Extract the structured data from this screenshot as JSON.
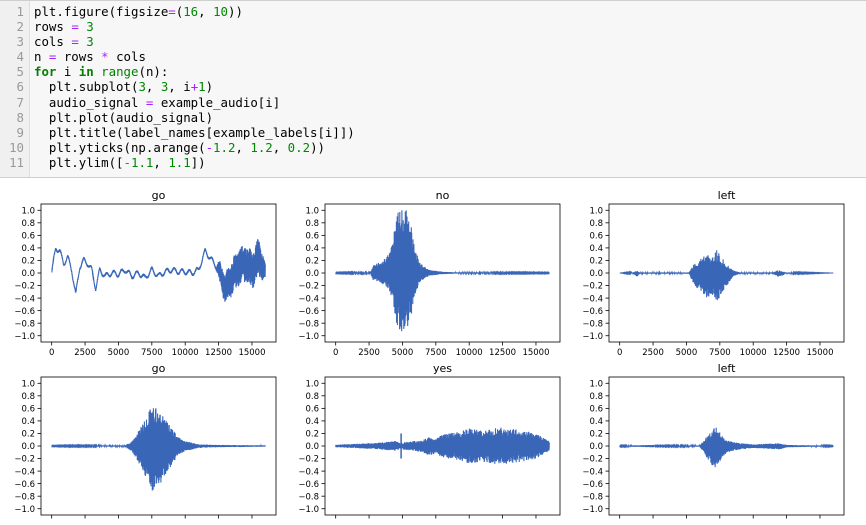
{
  "code_cell": {
    "lines": [
      {
        "n": "1",
        "tokens": [
          [
            "",
            "plt.figure(figsize"
          ],
          [
            "op",
            "="
          ],
          [
            "",
            "("
          ],
          [
            "num",
            "16"
          ],
          [
            "",
            ", "
          ],
          [
            "num",
            "10"
          ],
          [
            "",
            "))"
          ]
        ]
      },
      {
        "n": "2",
        "tokens": [
          [
            "",
            "rows "
          ],
          [
            "op",
            "="
          ],
          [
            "num",
            " 3"
          ]
        ]
      },
      {
        "n": "3",
        "tokens": [
          [
            "",
            "cols "
          ],
          [
            "op",
            "="
          ],
          [
            "num",
            " 3"
          ]
        ]
      },
      {
        "n": "4",
        "tokens": [
          [
            "",
            "n "
          ],
          [
            "op",
            "="
          ],
          [
            "",
            " rows "
          ],
          [
            "op",
            "*"
          ],
          [
            "",
            " cols"
          ]
        ]
      },
      {
        "n": "5",
        "tokens": [
          [
            "kw",
            "for"
          ],
          [
            "",
            " i "
          ],
          [
            "kw",
            "in"
          ],
          [
            "",
            " "
          ],
          [
            "bi",
            "range"
          ],
          [
            "",
            "(n):"
          ]
        ]
      },
      {
        "n": "6",
        "tokens": [
          [
            "",
            "  plt.subplot("
          ],
          [
            "num",
            "3"
          ],
          [
            "",
            ", "
          ],
          [
            "num",
            "3"
          ],
          [
            "",
            ", i"
          ],
          [
            "op",
            "+"
          ],
          [
            "num",
            "1"
          ],
          [
            "",
            ")"
          ]
        ]
      },
      {
        "n": "7",
        "tokens": [
          [
            "",
            "  audio_signal "
          ],
          [
            "op",
            "="
          ],
          [
            "",
            " example_audio[i]"
          ]
        ]
      },
      {
        "n": "8",
        "tokens": [
          [
            "",
            "  plt.plot(audio_signal)"
          ]
        ]
      },
      {
        "n": "9",
        "tokens": [
          [
            "",
            "  plt.title(label_names[example_labels[i]])"
          ]
        ]
      },
      {
        "n": "10",
        "tokens": [
          [
            "",
            "  plt.yticks(np.arange("
          ],
          [
            "op",
            "-"
          ],
          [
            "num",
            "1.2"
          ],
          [
            "",
            ", "
          ],
          [
            "num",
            "1.2"
          ],
          [
            "",
            ", "
          ],
          [
            "num",
            "0.2"
          ],
          [
            "",
            "))"
          ]
        ]
      },
      {
        "n": "11",
        "tokens": [
          [
            "",
            "  plt.ylim(["
          ],
          [
            "op",
            "-"
          ],
          [
            "num",
            "1.1"
          ],
          [
            "",
            ", "
          ],
          [
            "num",
            "1.1"
          ],
          [
            "",
            "])"
          ]
        ]
      }
    ]
  },
  "chart_data": [
    {
      "type": "line",
      "title": "go",
      "ylim": [
        -1.1,
        1.1
      ],
      "xlim": [
        -800,
        16800
      ],
      "yticks": [
        "1.0",
        "0.8",
        "0.6",
        "0.4",
        "0.2",
        "0.0",
        "−0.2",
        "−0.4",
        "−0.6",
        "−0.8",
        "−1.0"
      ],
      "xticks": [
        "0",
        "2500",
        "5000",
        "7500",
        "10000",
        "12500",
        "15000"
      ],
      "series_color": "#3a66b8",
      "envelope": [
        [
          0,
          0.0
        ],
        [
          300,
          0.4
        ],
        [
          600,
          0.35
        ],
        [
          900,
          0.15
        ],
        [
          1200,
          0.25
        ],
        [
          1500,
          0.05
        ],
        [
          1800,
          -0.35
        ],
        [
          2100,
          0.1
        ],
        [
          2400,
          0.2
        ],
        [
          2700,
          0.15
        ],
        [
          3000,
          0.05
        ],
        [
          3300,
          -0.25
        ],
        [
          3600,
          0.05
        ],
        [
          4000,
          -0.05
        ],
        [
          4500,
          0.0
        ],
        [
          5000,
          -0.02
        ],
        [
          5500,
          0.05
        ],
        [
          6000,
          -0.05
        ],
        [
          6500,
          0.0
        ],
        [
          7000,
          -0.08
        ],
        [
          7500,
          0.05
        ],
        [
          8000,
          -0.05
        ],
        [
          8500,
          0.02
        ],
        [
          9000,
          0.05
        ],
        [
          9500,
          0.02
        ],
        [
          10000,
          0.02
        ],
        [
          10500,
          0.0
        ],
        [
          11000,
          0.05
        ],
        [
          11500,
          0.35
        ],
        [
          12000,
          0.2
        ],
        [
          12500,
          0.05
        ],
        [
          13000,
          -0.25
        ],
        [
          13500,
          -0.1
        ],
        [
          14000,
          0.1
        ],
        [
          14500,
          0.15
        ],
        [
          15000,
          0.05
        ],
        [
          15500,
          0.25
        ],
        [
          16000,
          0.0
        ]
      ],
      "noise": [
        [
          0,
          0.02
        ],
        [
          12300,
          0.02
        ],
        [
          12600,
          0.18
        ],
        [
          13500,
          0.28
        ],
        [
          14500,
          0.28
        ],
        [
          15500,
          0.3
        ],
        [
          16000,
          0.15
        ]
      ]
    },
    {
      "type": "line",
      "title": "no",
      "ylim": [
        -1.1,
        1.1
      ],
      "xlim": [
        -800,
        16800
      ],
      "yticks": [
        "1.0",
        "0.8",
        "0.6",
        "0.4",
        "0.2",
        "0.0",
        "−0.2",
        "−0.4",
        "−0.6",
        "−0.8",
        "−1.0"
      ],
      "xticks": [
        "0",
        "2500",
        "5000",
        "7500",
        "10000",
        "12500",
        "15000"
      ],
      "series_color": "#3a66b8",
      "envelope": [
        [
          0,
          0
        ],
        [
          16000,
          0
        ]
      ],
      "noise": [
        [
          0,
          0.005
        ],
        [
          2600,
          0.01
        ],
        [
          2800,
          0.12
        ],
        [
          3500,
          0.18
        ],
        [
          4000,
          0.3
        ],
        [
          4300,
          0.55
        ],
        [
          4600,
          0.9
        ],
        [
          4900,
          0.98
        ],
        [
          5300,
          0.95
        ],
        [
          5600,
          0.8
        ],
        [
          5900,
          0.4
        ],
        [
          6300,
          0.15
        ],
        [
          7000,
          0.05
        ],
        [
          8000,
          0.02
        ],
        [
          9000,
          0.01
        ],
        [
          16000,
          0.005
        ]
      ],
      "skew": 0.05
    },
    {
      "type": "line",
      "title": "left",
      "ylim": [
        -1.1,
        1.1
      ],
      "xlim": [
        -800,
        16800
      ],
      "yticks": [
        "1.0",
        "0.8",
        "0.6",
        "0.4",
        "0.2",
        "0.0",
        "−0.2",
        "−0.4",
        "−0.6",
        "−0.8",
        "−1.0"
      ],
      "xticks": [
        "0",
        "2500",
        "5000",
        "7500",
        "10000",
        "12500",
        "15000"
      ],
      "series_color": "#3a66b8",
      "envelope": [
        [
          0,
          0
        ],
        [
          16000,
          0
        ]
      ],
      "noise": [
        [
          0,
          0.0
        ],
        [
          1000,
          0.01
        ],
        [
          1300,
          0.05
        ],
        [
          1500,
          0.01
        ],
        [
          5200,
          0.01
        ],
        [
          5500,
          0.15
        ],
        [
          6000,
          0.25
        ],
        [
          6500,
          0.35
        ],
        [
          7000,
          0.3
        ],
        [
          7300,
          0.45
        ],
        [
          7600,
          0.3
        ],
        [
          8000,
          0.18
        ],
        [
          8500,
          0.05
        ],
        [
          9000,
          0.01
        ],
        [
          11500,
          0.01
        ],
        [
          11800,
          0.05
        ],
        [
          12100,
          0.05
        ],
        [
          12400,
          0.01
        ],
        [
          16000,
          0.0
        ]
      ],
      "skew": -0.15
    },
    {
      "type": "line",
      "title": "go",
      "ylim": [
        -1.1,
        1.1
      ],
      "xlim": [
        -800,
        16800
      ],
      "yticks": [
        "1.0",
        "0.8",
        "0.6",
        "0.4",
        "0.2",
        "0.0",
        "−0.2",
        "−0.4",
        "−0.6",
        "−0.8",
        "−1.0"
      ],
      "xticks": [],
      "series_color": "#3a66b8",
      "envelope": [
        [
          0,
          0
        ],
        [
          16000,
          0
        ]
      ],
      "noise": [
        [
          0,
          0.005
        ],
        [
          5500,
          0.01
        ],
        [
          6000,
          0.08
        ],
        [
          6500,
          0.25
        ],
        [
          7000,
          0.45
        ],
        [
          7500,
          0.68
        ],
        [
          8000,
          0.62
        ],
        [
          8500,
          0.45
        ],
        [
          9000,
          0.3
        ],
        [
          9500,
          0.15
        ],
        [
          10000,
          0.08
        ],
        [
          11000,
          0.03
        ],
        [
          12000,
          0.02
        ],
        [
          16000,
          0.01
        ]
      ],
      "skew": -0.05
    },
    {
      "type": "line",
      "title": "yes",
      "ylim": [
        -1.1,
        1.1
      ],
      "xlim": [
        -800,
        16800
      ],
      "yticks": [
        "1.0",
        "0.8",
        "0.6",
        "0.4",
        "0.2",
        "0.0",
        "−0.2",
        "−0.4",
        "−0.6",
        "−0.8",
        "−1.0"
      ],
      "xticks": [],
      "series_color": "#3a66b8",
      "envelope": [
        [
          0,
          0
        ],
        [
          16000,
          0
        ]
      ],
      "noise": [
        [
          0,
          0.02
        ],
        [
          3000,
          0.05
        ],
        [
          4500,
          0.08
        ],
        [
          4800,
          0.05
        ],
        [
          6500,
          0.1
        ],
        [
          7000,
          0.15
        ],
        [
          7500,
          0.12
        ],
        [
          8000,
          0.18
        ],
        [
          9000,
          0.22
        ],
        [
          10000,
          0.28
        ],
        [
          11000,
          0.25
        ],
        [
          12000,
          0.3
        ],
        [
          13000,
          0.28
        ],
        [
          14000,
          0.25
        ],
        [
          15000,
          0.2
        ],
        [
          16000,
          0.08
        ]
      ],
      "spikes": [
        [
          4900,
          0.2
        ]
      ]
    },
    {
      "type": "line",
      "title": "left",
      "ylim": [
        -1.1,
        1.1
      ],
      "xlim": [
        -800,
        16800
      ],
      "yticks": [
        "1.0",
        "0.8",
        "0.6",
        "0.4",
        "0.2",
        "0.0",
        "−0.2",
        "−0.4",
        "−0.6",
        "−0.8",
        "−1.0"
      ],
      "xticks": [],
      "series_color": "#3a66b8",
      "envelope": [
        [
          0,
          0
        ],
        [
          16000,
          0
        ]
      ],
      "noise": [
        [
          0,
          0.005
        ],
        [
          2500,
          0.02
        ],
        [
          2700,
          0.005
        ],
        [
          6000,
          0.01
        ],
        [
          6300,
          0.1
        ],
        [
          6800,
          0.25
        ],
        [
          7200,
          0.35
        ],
        [
          7600,
          0.2
        ],
        [
          8000,
          0.1
        ],
        [
          9000,
          0.05
        ],
        [
          10000,
          0.03
        ],
        [
          12000,
          0.05
        ],
        [
          12500,
          0.02
        ],
        [
          16000,
          0.005
        ]
      ],
      "skew": -0.1
    }
  ]
}
